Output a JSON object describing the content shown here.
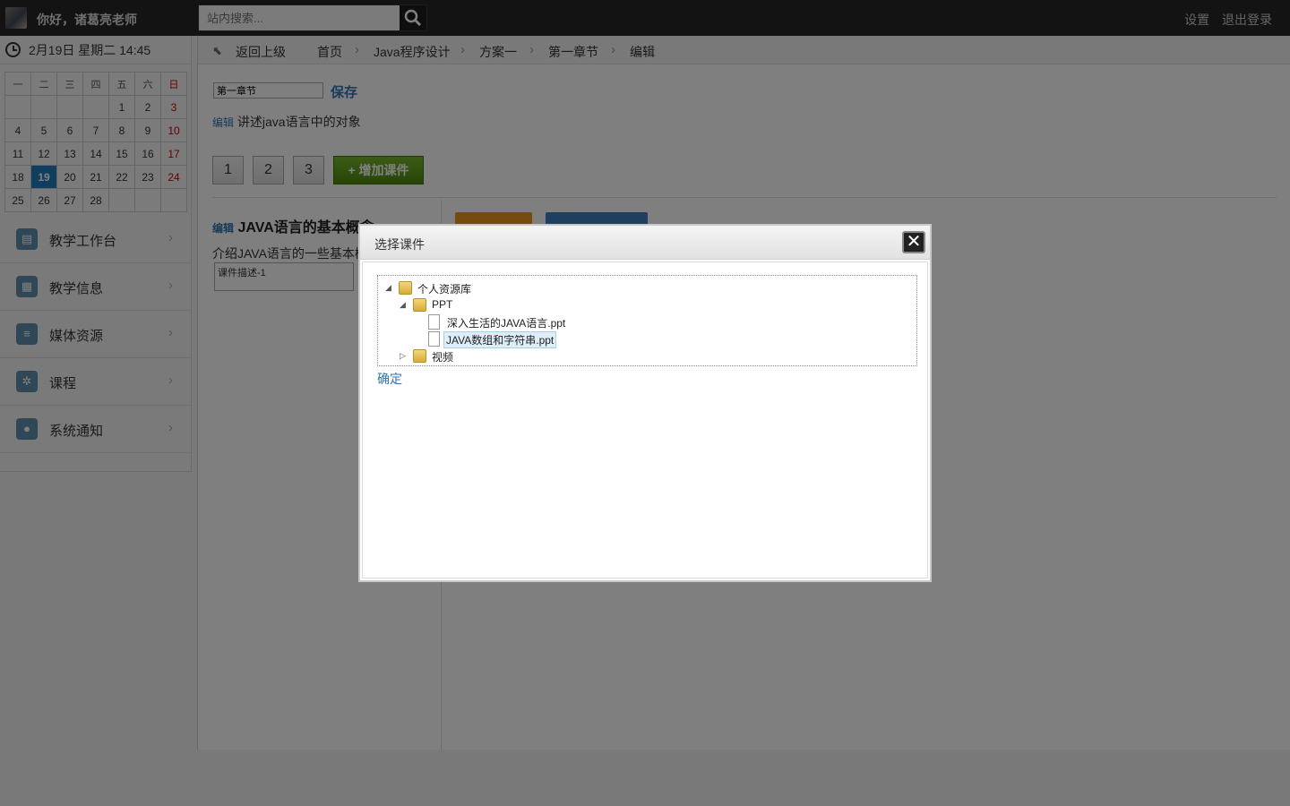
{
  "topbar": {
    "greeting": "你好，诸葛亮老师",
    "search_placeholder": "站内搜索...",
    "settings": "设置",
    "logout": "退出登录"
  },
  "sidebar": {
    "date": "2月19日 星期二 14:45",
    "calendar": {
      "weekdays": [
        "一",
        "二",
        "三",
        "四",
        "五",
        "六",
        "日"
      ],
      "weeks": [
        [
          "",
          "",
          "",
          "",
          "1",
          "2",
          "3"
        ],
        [
          "4",
          "5",
          "6",
          "7",
          "8",
          "9",
          "10"
        ],
        [
          "11",
          "12",
          "13",
          "14",
          "15",
          "16",
          "17"
        ],
        [
          "18",
          "19",
          "20",
          "21",
          "22",
          "23",
          "24"
        ],
        [
          "25",
          "26",
          "27",
          "28",
          "",
          "",
          ""
        ]
      ],
      "today": "19"
    },
    "items": [
      {
        "label": "教学工作台",
        "icon": "dashboard-icon"
      },
      {
        "label": "教学信息",
        "icon": "document-icon"
      },
      {
        "label": "媒体资源",
        "icon": "database-icon"
      },
      {
        "label": "课程",
        "icon": "gear-icon"
      },
      {
        "label": "系统通知",
        "icon": "chat-icon"
      }
    ]
  },
  "breadcrumb": {
    "back": "返回上级",
    "items": [
      "首页",
      "Java程序设计",
      "方案一",
      "第一章节",
      "编辑"
    ]
  },
  "editor": {
    "title_value": "第一章节",
    "save": "保存",
    "edit_label": "编辑",
    "description": "讲述java语言中的对象",
    "pages": [
      "1",
      "2",
      "3"
    ],
    "add_courseware": "+ 增加课件",
    "lesson_title": "JAVA语言的基本概念",
    "lesson_desc": "介绍JAVA语言的一些基本概念",
    "lesson_box": "课件描述-1"
  },
  "dialog": {
    "title": "选择课件",
    "tree": {
      "root": "个人资源库",
      "folder_ppt": "PPT",
      "file1": "深入生活的JAVA语言.ppt",
      "file2": "JAVA数组和字符串.ppt",
      "folder_video": "视频"
    },
    "confirm": "确定"
  }
}
